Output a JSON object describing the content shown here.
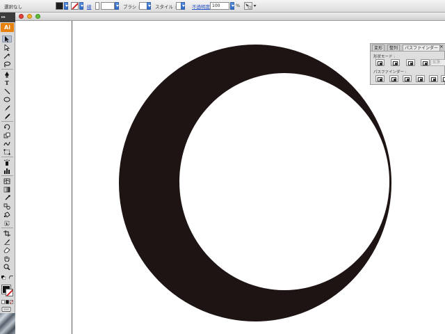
{
  "control_bar": {
    "selection_label": "選択なし",
    "stroke_label": "線",
    "brush_label": "ブラシ :",
    "style_label": "スタイル :",
    "opacity_label": "不透明度 :",
    "opacity_value": "100",
    "opacity_unit": "%"
  },
  "tools_panel": {
    "header": "▸▸",
    "logo_text": "Ai"
  },
  "pathfinder_panel": {
    "tabs": [
      "変形",
      "整列",
      "パスファインダー"
    ],
    "active_tab": "パスファインダー",
    "close_glyph": "×",
    "shape_modes_label": "形状モード :",
    "pathfinders_label": "パスファインダー :",
    "expand_label": "拡張"
  },
  "colors": {
    "crescent": "#1e1414",
    "canvas": "#ffffff",
    "logo": "#e8820f"
  }
}
